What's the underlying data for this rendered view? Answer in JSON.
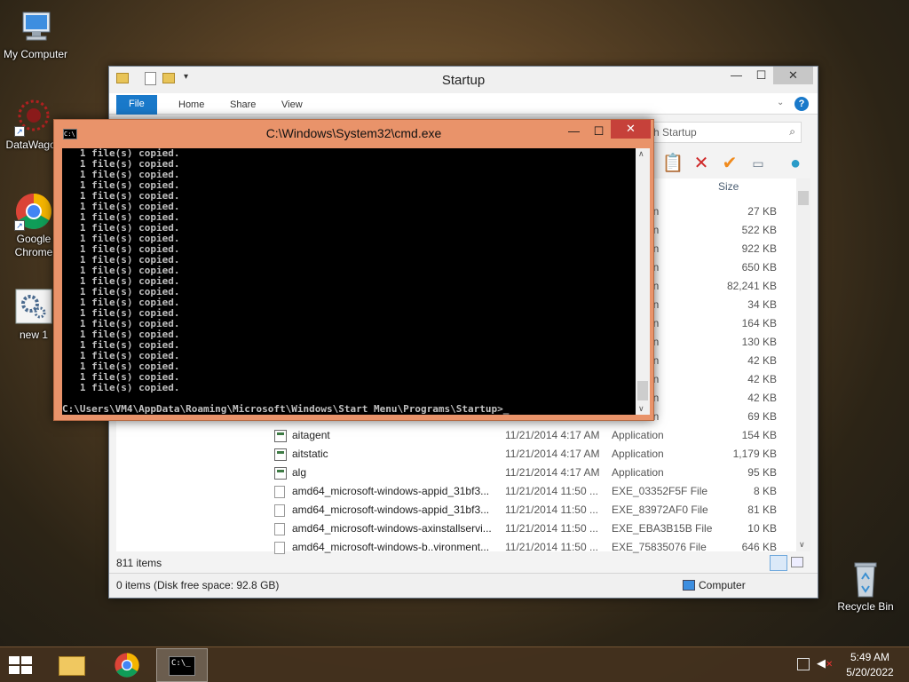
{
  "desktop": {
    "icons": [
      {
        "label": "My Computer"
      },
      {
        "label": "DataWagon"
      },
      {
        "label": "Google Chrome"
      },
      {
        "label": "new 1"
      },
      {
        "label": "Recycle Bin"
      }
    ]
  },
  "explorer": {
    "title": "Startup",
    "tabs": [
      "File",
      "Home",
      "Share",
      "View"
    ],
    "search_placeholder": "Search Startup",
    "search_visible": "h Startup",
    "column_size": "Size",
    "hidden_rows": [
      {
        "type": "on",
        "size": "27 KB"
      },
      {
        "type": "on",
        "size": "522 KB"
      },
      {
        "type": "on",
        "size": "922 KB"
      },
      {
        "type": "on",
        "size": "650 KB"
      },
      {
        "type": "on",
        "size": "82,241 KB"
      },
      {
        "type": "on",
        "size": "34 KB"
      },
      {
        "type": "on",
        "size": "164 KB"
      },
      {
        "type": "on",
        "size": "130 KB"
      },
      {
        "type": "on",
        "size": "42 KB"
      },
      {
        "type": "on",
        "size": "42 KB"
      },
      {
        "type": "on",
        "size": "42 KB"
      },
      {
        "type": "on",
        "size": "69 KB"
      }
    ],
    "files": [
      {
        "name": "aitagent",
        "date": "11/21/2014 4:17 AM",
        "type": "Application",
        "size": "154 KB",
        "icon": "app"
      },
      {
        "name": "aitstatic",
        "date": "11/21/2014 4:17 AM",
        "type": "Application",
        "size": "1,179 KB",
        "icon": "app"
      },
      {
        "name": "alg",
        "date": "11/21/2014 4:17 AM",
        "type": "Application",
        "size": "95 KB",
        "icon": "app"
      },
      {
        "name": "amd64_microsoft-windows-appid_31bf3...",
        "date": "11/21/2014 11:50 ...",
        "type": "EXE_03352F5F File",
        "size": "8 KB",
        "icon": "doc"
      },
      {
        "name": "amd64_microsoft-windows-appid_31bf3...",
        "date": "11/21/2014 11:50 ...",
        "type": "EXE_83972AF0 File",
        "size": "81 KB",
        "icon": "doc"
      },
      {
        "name": "amd64_microsoft-windows-axinstallservi...",
        "date": "11/21/2014 11:50 ...",
        "type": "EXE_EBA3B15B File",
        "size": "10 KB",
        "icon": "doc"
      },
      {
        "name": "amd64_microsoft-windows-b..vironment...",
        "date": "11/21/2014 11:50 ...",
        "type": "EXE_75835076 File",
        "size": "646 KB",
        "icon": "doc"
      }
    ],
    "item_count": "811 items",
    "status": "0 items (Disk free space: 92.8 GB)",
    "location": "Computer"
  },
  "cmd": {
    "title": "C:\\Windows\\System32\\cmd.exe",
    "copied_line": "   1 file(s) copied.",
    "copied_count": 23,
    "prompt": "C:\\Users\\VM4\\AppData\\Roaming\\Microsoft\\Windows\\Start Menu\\Programs\\Startup>_"
  },
  "taskbar": {
    "time": "5:49 AM",
    "date": "5/20/2022"
  }
}
